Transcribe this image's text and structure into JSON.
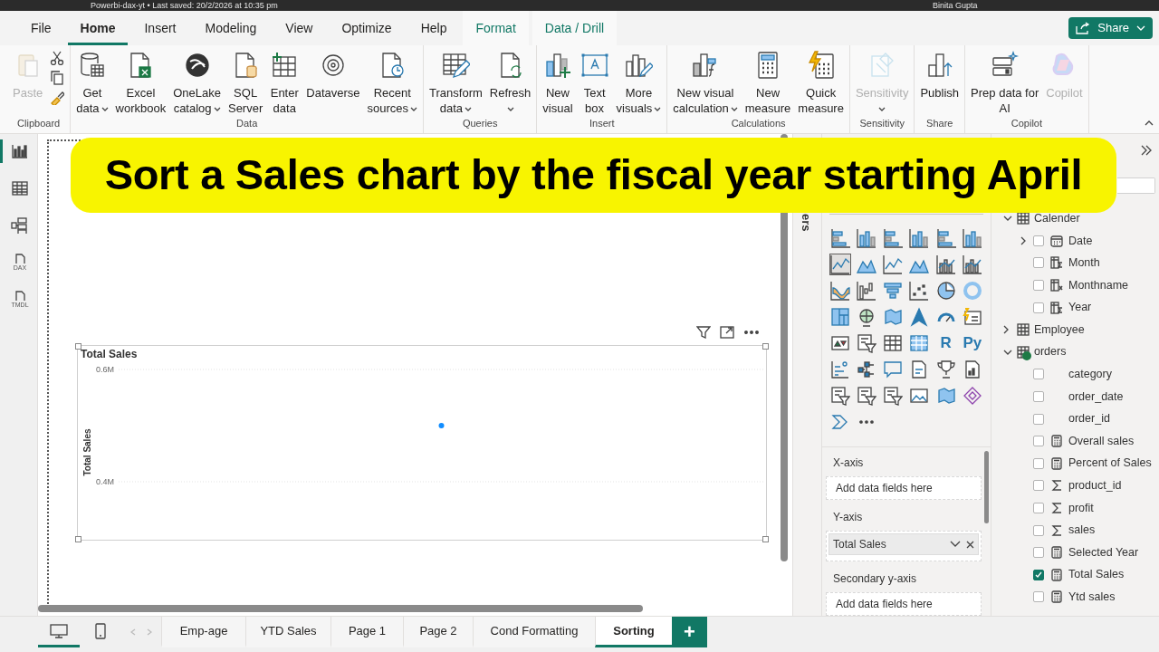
{
  "title_bar": {
    "title": "Powerbi-dax-yt • Last saved: 20/2/2026 at 10:35 pm",
    "user": "Binita Gupta"
  },
  "menu_tabs": [
    {
      "label": "File",
      "selected": false,
      "kind": "standard"
    },
    {
      "label": "Home",
      "selected": true,
      "kind": "standard"
    },
    {
      "label": "Insert",
      "selected": false,
      "kind": "standard"
    },
    {
      "label": "Modeling",
      "selected": false,
      "kind": "standard"
    },
    {
      "label": "View",
      "selected": false,
      "kind": "standard"
    },
    {
      "label": "Optimize",
      "selected": false,
      "kind": "standard"
    },
    {
      "label": "Help",
      "selected": false,
      "kind": "standard"
    },
    {
      "label": "Format",
      "selected": false,
      "kind": "contextual"
    },
    {
      "label": "Data / Drill",
      "selected": false,
      "kind": "contextual"
    }
  ],
  "share_button": {
    "label": "Share"
  },
  "ribbon_groups": [
    {
      "label": "Clipboard",
      "kind": "clipboard",
      "buttons": [
        {
          "lines": [
            "Paste"
          ],
          "dropdown": false,
          "disabled": true
        }
      ]
    },
    {
      "label": "Data",
      "kind": "standard",
      "buttons": [
        {
          "lines": [
            "Get",
            "data"
          ],
          "dropdown": true,
          "disabled": false
        },
        {
          "lines": [
            "Excel",
            "workbook"
          ],
          "dropdown": false,
          "disabled": false
        },
        {
          "lines": [
            "OneLake",
            "catalog"
          ],
          "dropdown": true,
          "disabled": false
        },
        {
          "lines": [
            "SQL",
            "Server"
          ],
          "dropdown": false,
          "disabled": false
        },
        {
          "lines": [
            "Enter",
            "data"
          ],
          "dropdown": false,
          "disabled": false
        },
        {
          "lines": [
            "Dataverse"
          ],
          "dropdown": false,
          "disabled": false
        },
        {
          "lines": [
            "Recent",
            "sources"
          ],
          "dropdown": true,
          "disabled": false
        }
      ]
    },
    {
      "label": "Queries",
      "kind": "standard",
      "buttons": [
        {
          "lines": [
            "Transform",
            "data"
          ],
          "dropdown": true,
          "disabled": false
        },
        {
          "lines": [
            "Refresh"
          ],
          "dropdown": true,
          "disabled": false
        }
      ]
    },
    {
      "label": "Insert",
      "kind": "standard",
      "buttons": [
        {
          "lines": [
            "New",
            "visual"
          ],
          "dropdown": false,
          "disabled": false
        },
        {
          "lines": [
            "Text",
            "box"
          ],
          "dropdown": false,
          "disabled": false
        },
        {
          "lines": [
            "More",
            "visuals"
          ],
          "dropdown": true,
          "disabled": false
        }
      ]
    },
    {
      "label": "Calculations",
      "kind": "standard",
      "buttons": [
        {
          "lines": [
            "New visual",
            "calculation"
          ],
          "dropdown": true,
          "disabled": false
        },
        {
          "lines": [
            "New",
            "measure"
          ],
          "dropdown": false,
          "disabled": false
        },
        {
          "lines": [
            "Quick",
            "measure"
          ],
          "dropdown": false,
          "disabled": false
        }
      ]
    },
    {
      "label": "Sensitivity",
      "kind": "standard",
      "buttons": [
        {
          "lines": [
            "Sensitivity"
          ],
          "dropdown": true,
          "disabled": true
        }
      ]
    },
    {
      "label": "Share",
      "kind": "standard",
      "buttons": [
        {
          "lines": [
            "Publish"
          ],
          "dropdown": false,
          "disabled": false
        }
      ]
    },
    {
      "label": "Copilot",
      "kind": "standard",
      "buttons": [
        {
          "lines": [
            "Prep data for",
            "AI"
          ],
          "dropdown": false,
          "disabled": false
        },
        {
          "lines": [
            "Copilot"
          ],
          "dropdown": false,
          "disabled": true
        }
      ]
    }
  ],
  "view_switcher": [
    {
      "selected": true
    },
    {
      "selected": false
    },
    {
      "selected": false
    },
    {
      "label": "DAX",
      "selected": false
    },
    {
      "label": "TMDL",
      "selected": false
    }
  ],
  "banner": {
    "text": "Sort a Sales chart by the fiscal year starting April"
  },
  "visual": {
    "chart_data": {
      "type": "line",
      "title": "Total Sales",
      "ylabel": "Total Sales",
      "ylim": [
        0.4,
        0.6
      ],
      "yticks": [
        {
          "value": 0.6,
          "label": "0.6M"
        },
        {
          "value": 0.4,
          "label": "0.4M"
        }
      ],
      "series": [
        {
          "color": "#118dff",
          "marker": true,
          "values": [
            0.5
          ]
        }
      ]
    }
  },
  "filters_pane": {
    "label": "ers"
  },
  "visual_types": [
    {
      "selected": false
    },
    {
      "selected": false
    },
    {
      "selected": false
    },
    {
      "selected": false
    },
    {
      "selected": false
    },
    {
      "selected": false
    },
    {
      "selected": true
    },
    {
      "selected": false
    },
    {
      "selected": false
    },
    {
      "selected": false
    },
    {
      "selected": false
    },
    {
      "selected": false
    },
    {
      "selected": false
    },
    {
      "selected": false
    },
    {
      "selected": false
    },
    {
      "selected": false
    },
    {
      "selected": false
    },
    {
      "selected": false
    },
    {
      "selected": false
    },
    {
      "selected": false
    },
    {
      "selected": false
    },
    {
      "selected": false
    },
    {
      "selected": false
    },
    {
      "selected": false
    },
    {
      "selected": false
    },
    {
      "selected": false
    },
    {
      "selected": false
    },
    {
      "selected": false
    },
    {
      "label": "R",
      "selected": false
    },
    {
      "label": "Py",
      "selected": false
    },
    {
      "selected": false
    },
    {
      "selected": false
    },
    {
      "selected": false
    },
    {
      "selected": false
    },
    {
      "selected": false
    },
    {
      "selected": false
    },
    {
      "selected": false
    },
    {
      "selected": false
    },
    {
      "selected": false
    },
    {
      "selected": false
    },
    {
      "selected": false
    },
    {
      "selected": false
    },
    {
      "selected": false
    },
    {
      "selected": false
    }
  ],
  "wells": [
    {
      "label": "X-axis",
      "placeholder": "Add data fields here"
    },
    {
      "label": "Y-axis",
      "fields": [
        "Total Sales"
      ]
    },
    {
      "label": "Secondary y-axis",
      "placeholder": "Add data fields here"
    }
  ],
  "data_tree": [
    {
      "label": "Calender",
      "expanded": true,
      "badge": false,
      "children": [
        {
          "label": "Date",
          "kind": "date",
          "checked": false,
          "expanded": false
        },
        {
          "label": "Month",
          "kind": "calc_column",
          "checked": false
        },
        {
          "label": "Monthname",
          "kind": "calc_text",
          "checked": false
        },
        {
          "label": "Year",
          "kind": "calc_column",
          "checked": false
        }
      ]
    },
    {
      "label": "Employee",
      "expanded": false,
      "badge": false
    },
    {
      "label": "orders",
      "expanded": true,
      "badge": true,
      "children": [
        {
          "label": "category",
          "kind": "plain",
          "checked": false
        },
        {
          "label": "order_date",
          "kind": "plain",
          "checked": false
        },
        {
          "label": "order_id",
          "kind": "plain",
          "checked": false
        },
        {
          "label": "Overall sales",
          "kind": "measure",
          "checked": false
        },
        {
          "label": "Percent of Sales",
          "kind": "measure",
          "checked": false
        },
        {
          "label": "product_id",
          "kind": "sum",
          "checked": false
        },
        {
          "label": "profit",
          "kind": "sum",
          "checked": false
        },
        {
          "label": "sales",
          "kind": "sum",
          "checked": false
        },
        {
          "label": "Selected Year",
          "kind": "measure",
          "checked": false
        },
        {
          "label": "Total Sales",
          "kind": "measure",
          "checked": true
        },
        {
          "label": "Ytd sales",
          "kind": "measure",
          "checked": false
        }
      ]
    }
  ],
  "view_modes": [
    {
      "kind": "desktop",
      "selected": true
    },
    {
      "kind": "mobile",
      "selected": false
    }
  ],
  "page_tabs": [
    {
      "label": "Emp-age",
      "selected": false
    },
    {
      "label": "YTD Sales",
      "selected": false
    },
    {
      "label": "Page 1",
      "selected": false
    },
    {
      "label": "Page 2",
      "selected": false
    },
    {
      "label": "Cond Formatting",
      "selected": false
    },
    {
      "label": "Sorting",
      "selected": true
    }
  ],
  "add_page_button": {
    "label": "+"
  }
}
